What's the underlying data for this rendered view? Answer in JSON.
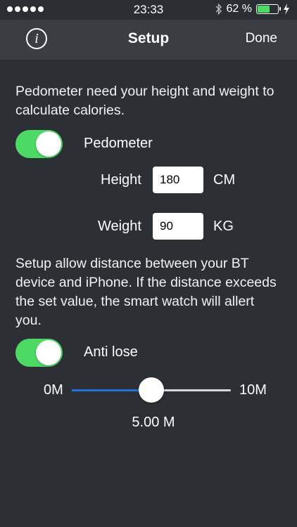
{
  "status_bar": {
    "time": "23:33",
    "battery_text": "62 %",
    "battery_level": 0.62,
    "icons": [
      "signal-dots-icon",
      "bluetooth-icon",
      "battery-icon",
      "charging-bolt-icon"
    ]
  },
  "nav": {
    "title": "Setup",
    "done_label": "Done",
    "info_symbol": "i"
  },
  "pedometer": {
    "description": "Pedometer need your height and weight to calculate calories.",
    "toggle_label": "Pedometer",
    "enabled": true,
    "height_label": "Height",
    "height_value": "180",
    "height_unit": "CM",
    "weight_label": "Weight",
    "weight_value": "90",
    "weight_unit": "KG"
  },
  "anti_lose": {
    "description": "Setup allow distance between your BT device and iPhone. If the distance exceeds the set value, the smart watch will allert you.",
    "toggle_label": "Anti lose",
    "enabled": true,
    "min_label": "0M",
    "max_label": "10M",
    "value_label": "5.00 M",
    "slider_fraction": 0.5
  },
  "colors": {
    "background": "#2c2f33",
    "nav_bar": "#3a3d42",
    "toggle_on": "#4cd964",
    "slider_fill": "#1e6fe0"
  }
}
